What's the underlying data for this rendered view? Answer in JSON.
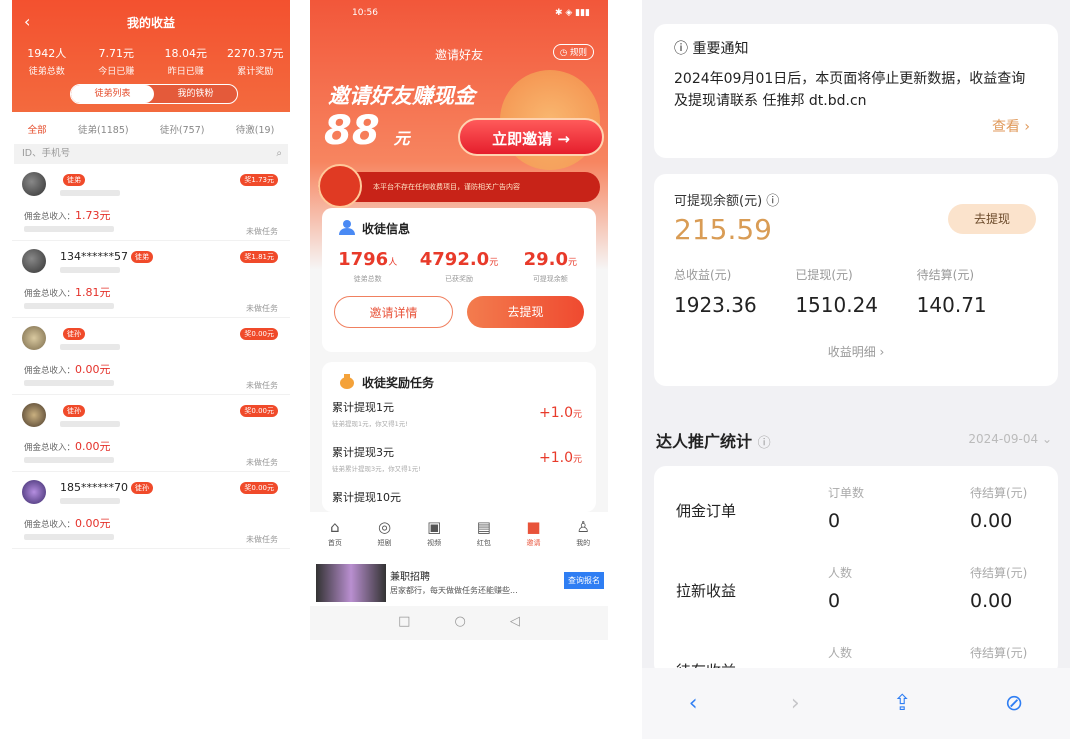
{
  "p1": {
    "title": "我的收益",
    "stats": [
      {
        "value": "1942人",
        "label": "徒弟总数"
      },
      {
        "value": "7.71元",
        "label": "今日已赚"
      },
      {
        "value": "18.04元",
        "label": "昨日已赚"
      },
      {
        "value": "2270.37元",
        "label": "累计奖励"
      }
    ],
    "seg": [
      "徒弟列表",
      "我的铁粉"
    ],
    "filters": [
      "全部",
      "徒弟(1185)",
      "徒孙(757)",
      "待激(19)"
    ],
    "search_placeholder": "ID、手机号",
    "items": [
      {
        "phone": "",
        "tag": "徒弟",
        "rtag": "奖1.73元",
        "earn_label": "佣金总收入：",
        "earn": "1.73元",
        "task": "未做任务"
      },
      {
        "phone": "134******57",
        "tag": "徒弟",
        "rtag": "奖1.81元",
        "earn_label": "佣金总收入：",
        "earn": "1.81元",
        "task": "未做任务"
      },
      {
        "phone": "",
        "tag": "徒孙",
        "rtag": "奖0.00元",
        "earn_label": "佣金总收入：",
        "earn": "0.00元",
        "task": "未做任务"
      },
      {
        "phone": "",
        "tag": "徒孙",
        "rtag": "奖0.00元",
        "earn_label": "佣金总收入：",
        "earn": "0.00元",
        "task": "未做任务"
      },
      {
        "phone": "185******70",
        "tag": "徒孙",
        "rtag": "奖0.00元",
        "earn_label": "佣金总收入：",
        "earn": "0.00元",
        "task": "未做任务"
      }
    ]
  },
  "p2": {
    "time": "10:56",
    "nav_title": "邀请好友",
    "rule": "规则",
    "headline": "邀请好友赚现金",
    "amount": "88",
    "amount_unit": "元",
    "invite": "立即邀请 →",
    "banner": "本平台不存在任何收费项目，谨防相关广告内容",
    "income_title": "收徒信息",
    "nums": [
      {
        "value": "1796",
        "unit": "人",
        "label": "徒弟总数"
      },
      {
        "value": "4792.0",
        "unit": "元",
        "label": "已获奖励"
      },
      {
        "value": "29.0",
        "unit": "元",
        "label": "可提现余额"
      }
    ],
    "btn_detail": "邀请详情",
    "btn_withdraw": "去提现",
    "task_title": "收徒奖励任务",
    "tasks": [
      {
        "name": "累计提现1元",
        "desc": "徒弟提现1元，你又得1元!",
        "reward": "+1.0",
        "unit": "元"
      },
      {
        "name": "累计提现3元",
        "desc": "徒弟累计提现3元，你又得1元!",
        "reward": "+1.0",
        "unit": "元"
      },
      {
        "name": "累计提现10元",
        "desc": "",
        "reward": "",
        "unit": ""
      }
    ],
    "tabs": [
      "首页",
      "短剧",
      "视频",
      "红包",
      "邀请",
      "我的"
    ],
    "ad_title": "兼职招聘",
    "ad_desc": "居家都行，每天做做任务还能赚些...",
    "ad_button": "查询报名"
  },
  "p3": {
    "notice_title": "重要通知",
    "notice_body": "2024年09月01日后，本页面将停止更新数据，收益查询及提现请联系 任推邦 dt.bd.cn",
    "notice_more": "查看",
    "balance_label": "可提现余额(元)",
    "balance": "215.59",
    "withdraw": "去提现",
    "trio": [
      {
        "label": "总收益(元)",
        "value": "1923.36"
      },
      {
        "label": "已提现(元)",
        "value": "1510.24"
      },
      {
        "label": "待结算(元)",
        "value": "140.71"
      }
    ],
    "detail": "收益明细 ›",
    "section": "达人推广统计",
    "date": "2024-09-04",
    "rows": [
      {
        "name": "佣金订单",
        "l1": "订单数",
        "v1": "0",
        "l2": "待结算(元)",
        "v2": "0.00"
      },
      {
        "name": "拉新收益",
        "l1": "人数",
        "v1": "0",
        "l2": "待结算(元)",
        "v2": "0.00"
      },
      {
        "name": "待存收益",
        "l1": "人数",
        "v1": "",
        "l2": "待结算(元)",
        "v2": ""
      }
    ]
  }
}
